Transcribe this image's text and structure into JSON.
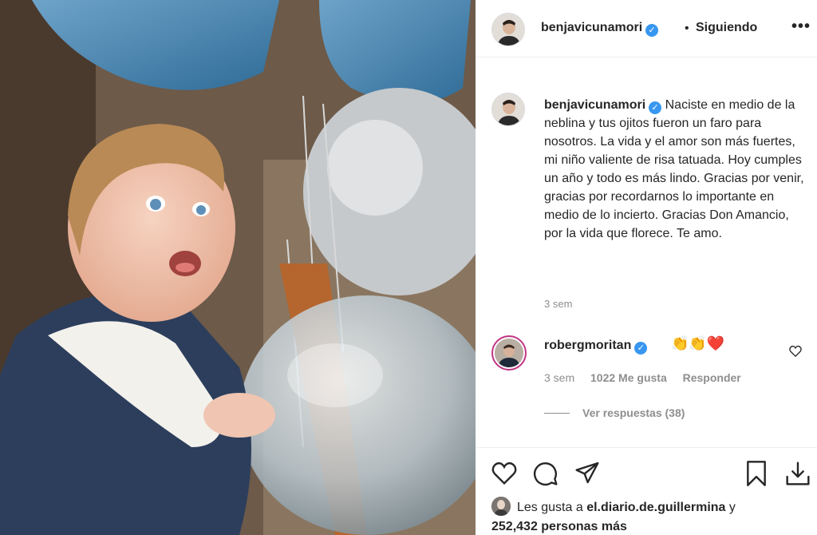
{
  "post": {
    "username": "benjavicunamori",
    "follow_status": "Siguiendo",
    "more_label": "•••",
    "caption": "Naciste en medio de la neblina y tus ojitos fueron un faro para nosotros. La vida y el amor son más fuertes, mi niño valiente de risa tatuada. Hoy cumples un año y todo es más lindo. Gracias por venir, gracias por recordarnos lo importante en medio de lo incierto. Gracias Don Amancio, por la vida que florece. Te amo.",
    "caption_time": "3 sem"
  },
  "comment": {
    "username": "robergmoritan",
    "text": "👏👏❤️",
    "time": "3 sem",
    "likes": "1022 Me gusta",
    "reply_label": "Responder",
    "view_replies": "Ver respuestas (38)"
  },
  "likes_summary": {
    "prefix": "Les gusta a",
    "liker": "el.diario.de.guillermina",
    "connector": "y",
    "others": "252,432 personas más"
  },
  "colors": {
    "verified": "#3897f0",
    "text": "#262626",
    "muted": "#8e8e8e",
    "story_ring": "#c13584"
  },
  "icons": {
    "verified": "verified-badge-icon",
    "like": "heart-icon",
    "comment": "comment-bubble-icon",
    "share": "paper-plane-icon",
    "save": "bookmark-icon",
    "download": "download-icon"
  }
}
